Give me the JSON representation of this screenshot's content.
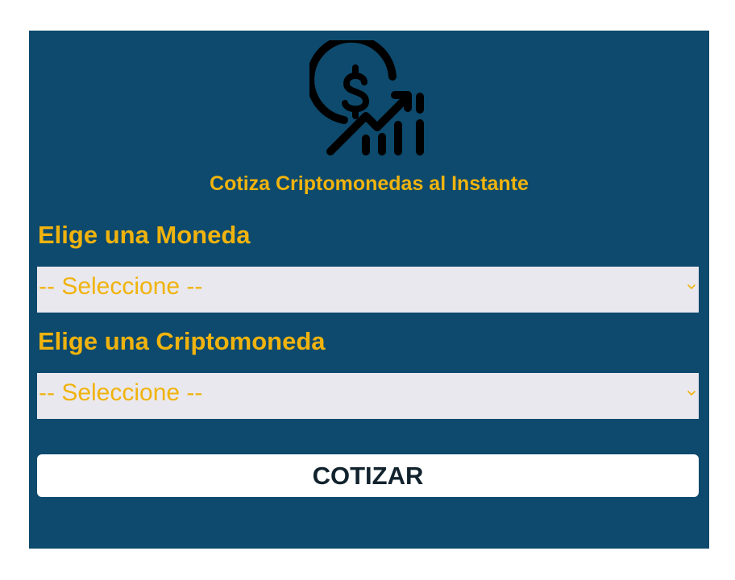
{
  "header": {
    "logo_icon": "dollar-growth-icon",
    "subtitle": "Cotiza Criptomonedas al Instante"
  },
  "form": {
    "currency": {
      "label": "Elige una Moneda",
      "selected": "-- Seleccione --"
    },
    "crypto": {
      "label": "Elige una Criptomoneda",
      "selected": "-- Seleccione --"
    },
    "submit_label": "COTIZAR"
  },
  "colors": {
    "panel_background": "#0d4a6d",
    "accent": "#f0b30e",
    "select_background": "#e9e8ee",
    "button_background": "#ffffff",
    "button_text": "#12232e"
  }
}
